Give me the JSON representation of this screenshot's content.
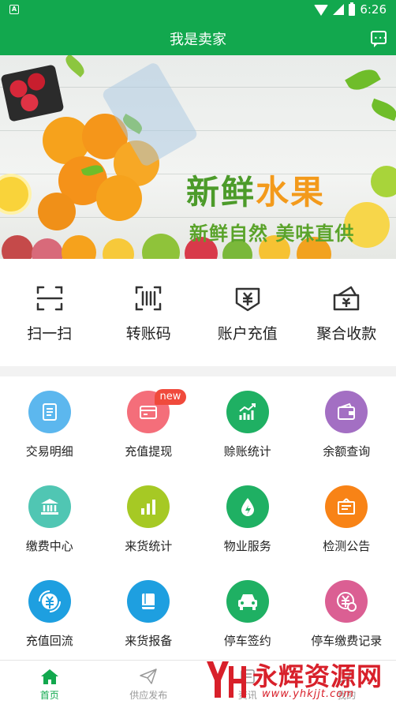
{
  "status_bar": {
    "left_icon": "A",
    "time": "6:26"
  },
  "app_bar": {
    "title": "我是卖家",
    "message_icon": "message-icon"
  },
  "banner": {
    "headline_part1": "新鲜",
    "headline_part2": "水果",
    "subline": "新鲜自然 美味直供"
  },
  "quick_actions": [
    {
      "label": "扫一扫",
      "icon": "scan-icon"
    },
    {
      "label": "转账码",
      "icon": "transfer-code-icon"
    },
    {
      "label": "账户充值",
      "icon": "account-recharge-icon"
    },
    {
      "label": "聚合收款",
      "icon": "aggregate-payment-icon"
    }
  ],
  "grid": [
    {
      "label": "交易明细",
      "icon": "document-icon",
      "color": "#5cb7ee"
    },
    {
      "label": "充值提现",
      "icon": "card-icon",
      "color": "#f46e7a",
      "badge": "new"
    },
    {
      "label": "赊账统计",
      "icon": "trend-chart-icon",
      "color": "#1fb063"
    },
    {
      "label": "余额查询",
      "icon": "wallet-icon",
      "color": "#a36fc3"
    },
    {
      "label": "缴费中心",
      "icon": "bank-icon",
      "color": "#50c6b3"
    },
    {
      "label": "来货统计",
      "icon": "bar-chart-icon",
      "color": "#a6c924"
    },
    {
      "label": "物业服务",
      "icon": "water-drop-icon",
      "color": "#1fb063"
    },
    {
      "label": "检测公告",
      "icon": "notice-board-icon",
      "color": "#f88316"
    },
    {
      "label": "充值回流",
      "icon": "yuan-cycle-icon",
      "color": "#1e9fe0"
    },
    {
      "label": "来货报备",
      "icon": "book-icon",
      "color": "#1e9fe0"
    },
    {
      "label": "停车签约",
      "icon": "car-icon",
      "color": "#1fb063"
    },
    {
      "label": "停车缴费记录",
      "icon": "parking-fee-icon",
      "color": "#db5f93"
    }
  ],
  "bottom_nav": [
    {
      "label": "首页",
      "icon": "home-icon",
      "active": true
    },
    {
      "label": "供应发布",
      "icon": "send-icon",
      "active": false
    },
    {
      "label": "资讯",
      "icon": "news-icon",
      "active": false
    },
    {
      "label": "我的",
      "icon": "profile-icon",
      "active": false
    }
  ],
  "watermark": {
    "title": "永辉资源网",
    "url": "www.yhkjjt.com"
  },
  "colors": {
    "primary": "#12a84e",
    "badge": "#f04a3c",
    "watermark": "#d8202a"
  }
}
